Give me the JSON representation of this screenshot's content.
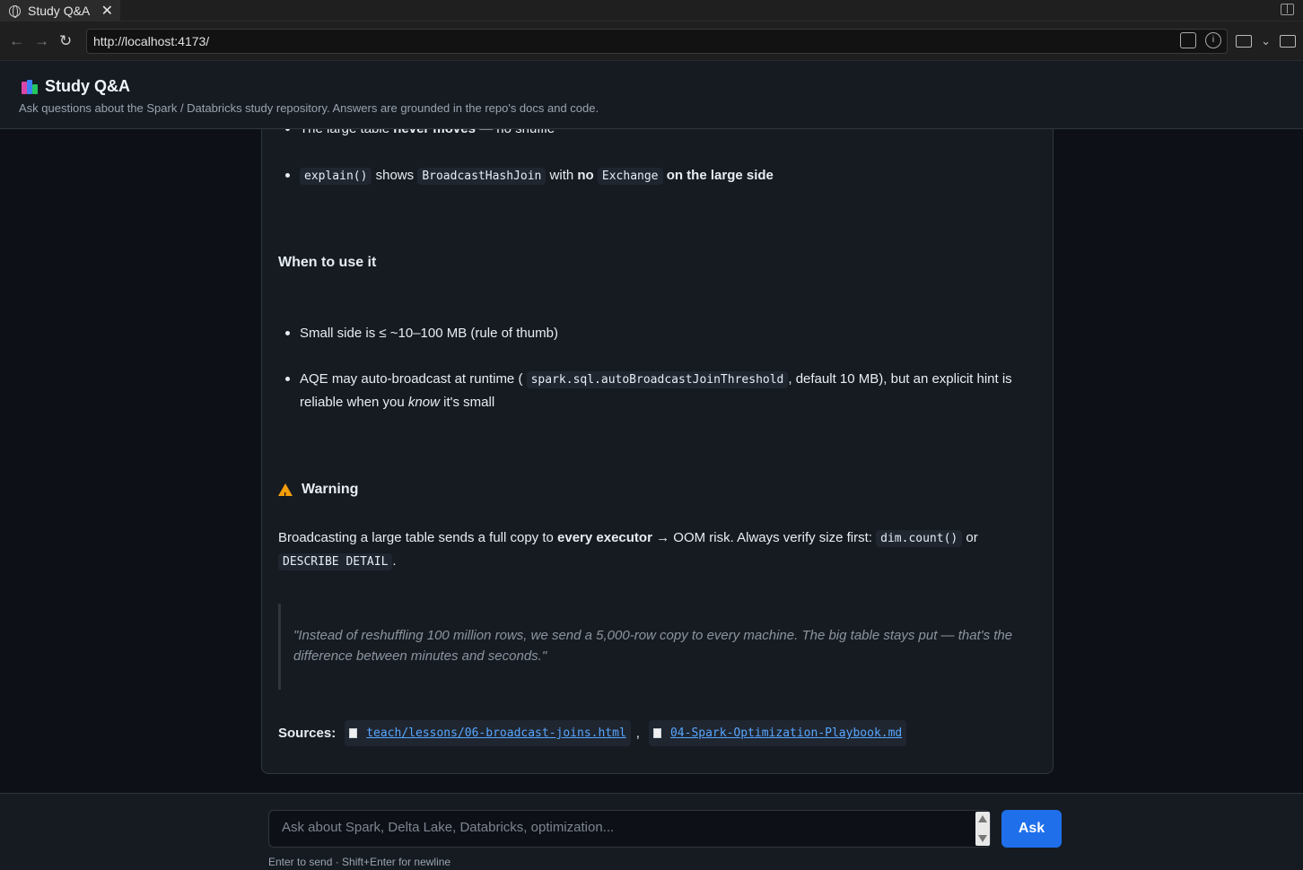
{
  "browser": {
    "tab_title": "Study Q&A",
    "url": "http://localhost:4173/"
  },
  "header": {
    "title": "Study Q&A",
    "subtitle": "Ask questions about the Spark / Databricks study repository. Answers are grounded in the repo's docs and code."
  },
  "answer": {
    "top_bullets": [
      {
        "pre": "The large table ",
        "bold": "never moves",
        "post": " — no shuffle"
      },
      {
        "code1": "explain()",
        "t1": " shows ",
        "code2": "BroadcastHashJoin",
        "t2": " with ",
        "bold1": "no",
        "code3": "Exchange",
        "bold2": "on the large side"
      }
    ],
    "when_heading": "When to use it",
    "when_bullets": [
      {
        "text": "Small side is ≤ ~10–100 MB (rule of thumb)"
      },
      {
        "pre": "AQE may auto-broadcast at runtime (",
        "code": "spark.sql.autoBroadcastJoinThreshold",
        "mid": ", default 10 MB), but an explicit hint is reliable when you ",
        "em": "know",
        "post": " it's small"
      }
    ],
    "warning_heading": "Warning",
    "warning": {
      "pre": "Broadcasting a large table sends a full copy to ",
      "bold": "every executor",
      "mid": " → OOM risk. Always verify size first: ",
      "code1": "dim.count()",
      "or": " or",
      "code2": "DESCRIBE DETAIL",
      "end": "."
    },
    "quote": "\"Instead of reshuffling 100 million rows, we send a 5,000-row copy to every machine. The big table stays put — that's the difference between minutes and seconds.\"",
    "sources_label": "Sources:",
    "sources": [
      "teach/lessons/06-broadcast-joins.html",
      "04-Spark-Optimization-Playbook.md"
    ],
    "sources_sep": ","
  },
  "composer": {
    "placeholder": "Ask about Spark, Delta Lake, Databricks, optimization...",
    "ask_label": "Ask",
    "hint": "Enter to send · Shift+Enter for newline"
  }
}
